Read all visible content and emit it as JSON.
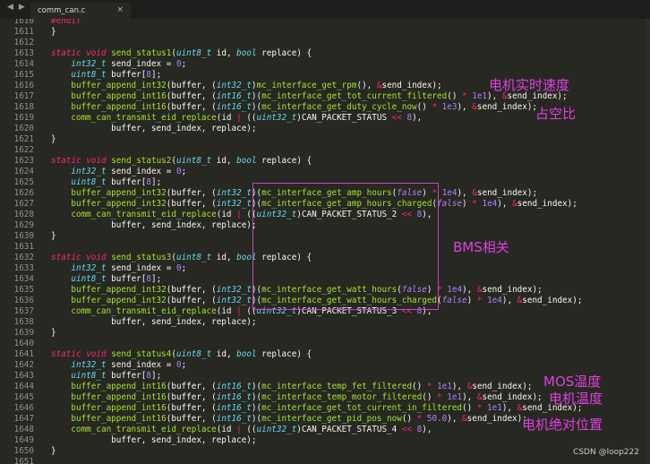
{
  "tabbar": {
    "nav_back": "◀",
    "nav_forward": "▶",
    "tab_title": "comm_can.c",
    "close_glyph": "×"
  },
  "editor": {
    "lines": [
      {
        "no": "1610",
        "code": "#endif"
      },
      {
        "no": "1611",
        "code": "}"
      },
      {
        "no": "1612",
        "code": ""
      },
      {
        "no": "1613",
        "code": "static void send_status1(uint8_t id, bool replace) {"
      },
      {
        "no": "1614",
        "code": "    int32_t send_index = 0;"
      },
      {
        "no": "1615",
        "code": "    uint8_t buffer[8];"
      },
      {
        "no": "1616",
        "code": "    buffer_append_int32(buffer, (int32_t)mc_interface_get_rpm(), &send_index);"
      },
      {
        "no": "1617",
        "code": "    buffer_append_int16(buffer, (int16_t)(mc_interface_get_tot_current_filtered() * 1e1), &send_index);"
      },
      {
        "no": "1618",
        "code": "    buffer_append_int16(buffer, (int16_t)(mc_interface_get_duty_cycle_now() * 1e3), &send_index);"
      },
      {
        "no": "1619",
        "code": "    comm_can_transmit_eid_replace(id | ((uint32_t)CAN_PACKET_STATUS << 8),"
      },
      {
        "no": "1620",
        "code": "            buffer, send_index, replace);"
      },
      {
        "no": "1621",
        "code": "}"
      },
      {
        "no": "1622",
        "code": ""
      },
      {
        "no": "1623",
        "code": "static void send_status2(uint8_t id, bool replace) {"
      },
      {
        "no": "1624",
        "code": "    int32_t send_index = 0;"
      },
      {
        "no": "1625",
        "code": "    uint8_t buffer[8];"
      },
      {
        "no": "1626",
        "code": "    buffer_append_int32(buffer, (int32_t)(mc_interface_get_amp_hours(false) * 1e4), &send_index);"
      },
      {
        "no": "1627",
        "code": "    buffer_append_int32(buffer, (int32_t)(mc_interface_get_amp_hours_charged(false) * 1e4), &send_index);"
      },
      {
        "no": "1628",
        "code": "    comm_can_transmit_eid_replace(id | ((uint32_t)CAN_PACKET_STATUS_2 << 8),"
      },
      {
        "no": "1629",
        "code": "            buffer, send_index, replace);"
      },
      {
        "no": "1630",
        "code": "}"
      },
      {
        "no": "1631",
        "code": ""
      },
      {
        "no": "1632",
        "code": "static void send_status3(uint8_t id, bool replace) {"
      },
      {
        "no": "1633",
        "code": "    int32_t send_index = 0;"
      },
      {
        "no": "1634",
        "code": "    uint8_t buffer[8];"
      },
      {
        "no": "1635",
        "code": "    buffer_append_int32(buffer, (int32_t)(mc_interface_get_watt_hours(false) * 1e4), &send_index);"
      },
      {
        "no": "1636",
        "code": "    buffer_append_int32(buffer, (int32_t)(mc_interface_get_watt_hours_charged(false) * 1e4), &send_index);"
      },
      {
        "no": "1637",
        "code": "    comm_can_transmit_eid_replace(id | ((uint32_t)CAN_PACKET_STATUS_3 << 8),"
      },
      {
        "no": "1638",
        "code": "            buffer, send_index, replace);"
      },
      {
        "no": "1639",
        "code": "}"
      },
      {
        "no": "1640",
        "code": ""
      },
      {
        "no": "1641",
        "code": "static void send_status4(uint8_t id, bool replace) {"
      },
      {
        "no": "1642",
        "code": "    int32_t send_index = 0;"
      },
      {
        "no": "1643",
        "code": "    uint8_t buffer[8];"
      },
      {
        "no": "1644",
        "code": "    buffer_append_int16(buffer, (int16_t)(mc_interface_temp_fet_filtered() * 1e1), &send_index);"
      },
      {
        "no": "1645",
        "code": "    buffer_append_int16(buffer, (int16_t)(mc_interface_temp_motor_filtered() * 1e1), &send_index);"
      },
      {
        "no": "1646",
        "code": "    buffer_append_int16(buffer, (int16_t)(mc_interface_get_tot_current_in_filtered() * 1e1), &send_index);"
      },
      {
        "no": "1647",
        "code": "    buffer_append_int16(buffer, (int16_t)(mc_interface_get_pid_pos_now() * 50.0), &send_index);"
      },
      {
        "no": "1648",
        "code": "    comm_can_transmit_eid_replace(id | ((uint32_t)CAN_PACKET_STATUS_4 << 8),"
      },
      {
        "no": "1649",
        "code": "            buffer, send_index, replace);"
      },
      {
        "no": "1650",
        "code": "}"
      },
      {
        "no": "1651",
        "code": ""
      }
    ]
  },
  "annotations": {
    "motor_speed": "电机实时速度",
    "duty_cycle": "占空比",
    "bms": "BMS相关",
    "mos_temp": "MOS温度",
    "motor_temp": "电机温度",
    "motor_abs_pos": "电机绝对位置"
  },
  "watermark": "CSDN @loop222",
  "colors": {
    "background": "#272822",
    "annotation": "#e040e0",
    "keyword": "#f92672",
    "type": "#66d9ef",
    "function": "#a6e22e",
    "number": "#ae81ff"
  }
}
